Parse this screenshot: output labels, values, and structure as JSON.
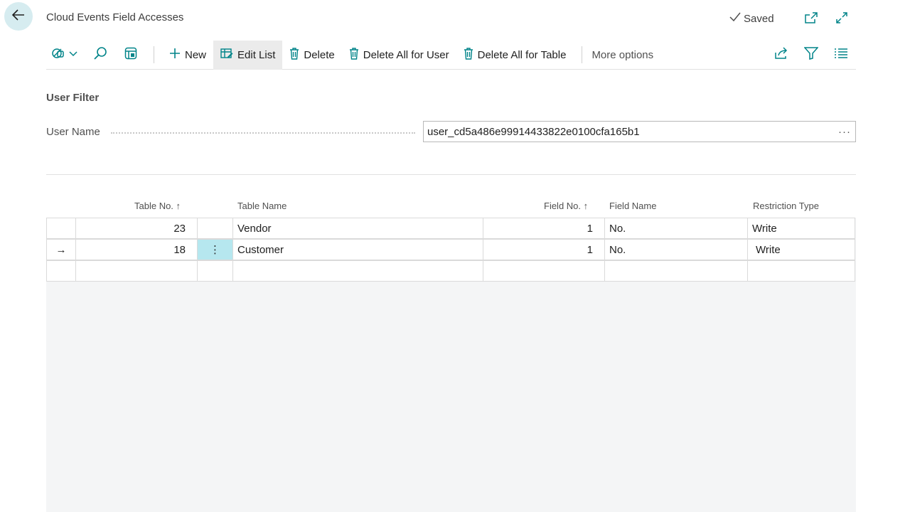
{
  "header": {
    "title": "Cloud Events Field Accesses",
    "status": "Saved"
  },
  "toolbar": {
    "new_label": "New",
    "edit_list_label": "Edit List",
    "delete_label": "Delete",
    "delete_all_user_label": "Delete All for User",
    "delete_all_table_label": "Delete All for Table",
    "more_options_label": "More options"
  },
  "filter": {
    "section_title": "User Filter",
    "user_name_label": "User Name",
    "user_name_value": "user_cd5a486e99914433822e0100cfa165b1",
    "ellipsis": "···"
  },
  "table": {
    "columns": {
      "table_no": "Table No. ↑",
      "table_name": "Table Name",
      "field_no": "Field No. ↑",
      "field_name": "Field Name",
      "restriction_type": "Restriction Type"
    },
    "rows": [
      {
        "indicator": "",
        "table_no": "23",
        "menu": "",
        "table_name": "Vendor",
        "field_no": "1",
        "field_name": "No.",
        "restriction_type": "Write"
      },
      {
        "indicator": "→",
        "table_no": "18",
        "menu": "⋮",
        "table_name": "Customer",
        "field_no": "1",
        "field_name": "No.",
        "restriction_type": "Write"
      },
      {
        "indicator": "",
        "table_no": "",
        "menu": "",
        "table_name": "",
        "field_no": "",
        "field_name": "",
        "restriction_type": ""
      }
    ]
  },
  "colors": {
    "accent": "#008489",
    "selected_cell": "#b6e7ef",
    "back_button": "#d6ecf0"
  }
}
